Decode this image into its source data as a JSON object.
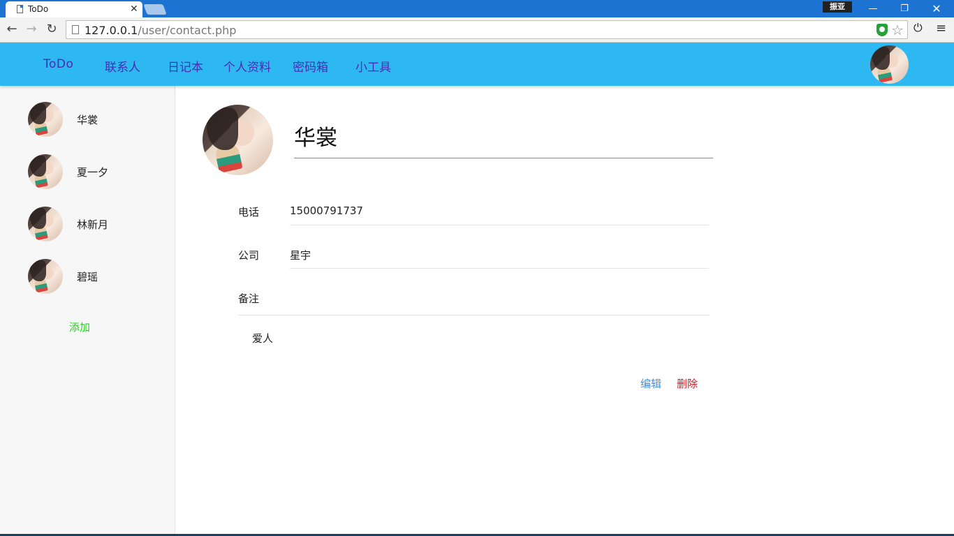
{
  "browser": {
    "tab_title": "ToDo",
    "close_glyph": "✕",
    "ime_label": "振亚",
    "url_host": "127.0.0.1",
    "url_path": "/user/contact.php",
    "icons": [
      "back-icon",
      "forward-icon",
      "reload-icon",
      "page-icon",
      "shield-icon",
      "star-icon",
      "power-icon",
      "menu-icon"
    ]
  },
  "nav": {
    "brand": "ToDo",
    "items": [
      {
        "label": "联系人"
      },
      {
        "label": "日记本"
      },
      {
        "label": "个人资料"
      },
      {
        "label": "密码箱"
      },
      {
        "label": "小工具"
      }
    ],
    "bar_color": "#2eb8f2",
    "link_color": "#4b2bb2"
  },
  "sidebar": {
    "contacts": [
      {
        "name": "华裳"
      },
      {
        "name": "夏一夕"
      },
      {
        "name": "林新月"
      },
      {
        "name": "碧瑶"
      }
    ],
    "add_label": "添加"
  },
  "detail": {
    "name": "华裳",
    "fields": {
      "phone": {
        "label": "电话",
        "value": "15000791737"
      },
      "company": {
        "label": "公司",
        "value": "星宇"
      },
      "note": {
        "label": "备注",
        "value": "爱人"
      }
    },
    "edit_label": "编辑",
    "delete_label": "删除"
  }
}
